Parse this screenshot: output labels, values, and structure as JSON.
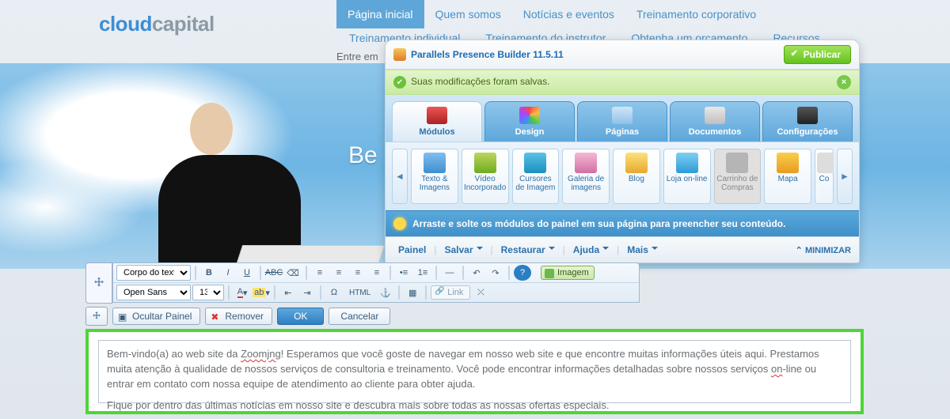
{
  "logo": {
    "part1": "cloud",
    "part2": "capital"
  },
  "nav1": [
    "Página inicial",
    "Quem somos",
    "Notícias e eventos",
    "Treinamento corporativo"
  ],
  "nav2": [
    "Treinamento individual",
    "Treinamento do instrutor",
    "Obtenha um orçamento",
    "Recursos"
  ],
  "subline_prefix": "Entre em",
  "hero_text": "Be",
  "builder": {
    "title": "Parallels Presence Builder 11.5.11",
    "publish": "Publicar",
    "saved_msg": "Suas modificações foram salvas.",
    "tabs": [
      "Módulos",
      "Design",
      "Páginas",
      "Documentos",
      "Configurações"
    ],
    "modules": [
      {
        "label": "Texto & Imagens"
      },
      {
        "label": "Vídeo Incorporado"
      },
      {
        "label": "Cursores de Imagem"
      },
      {
        "label": "Galeria de imagens"
      },
      {
        "label": "Blog"
      },
      {
        "label": "Loja on-line"
      },
      {
        "label": "Carrinho de Compras",
        "disabled": true
      },
      {
        "label": "Mapa"
      },
      {
        "label": "Co"
      }
    ],
    "hint": "Arraste e solte os módulos do painel em sua página para preencher seu conteúdo.",
    "footer": {
      "panel": "Painel",
      "save": "Salvar",
      "restore": "Restaurar",
      "help": "Ajuda",
      "more": "Mais",
      "minimize": "MINIMIZAR"
    }
  },
  "rte": {
    "para_style": "Corpo do texto",
    "font": "Open Sans",
    "size": "13",
    "image_btn": "Imagem",
    "link_btn": "Link",
    "html_btn": "HTML"
  },
  "actions": {
    "hide_panel": "Ocultar Painel",
    "remove": "Remover",
    "ok": "OK",
    "cancel": "Cancelar"
  },
  "content": {
    "p1a": "Bem-vindo(a) ao web site da ",
    "p1_s1": "Zoomjng",
    "p1b": "! Esperamos que você goste de navegar em nosso web site e que encontre muitas informações úteis aqui. Prestamos muita atenção à qualidade de nossos serviços de consultoria e treinamento. Você pode encontrar informações detalhadas sobre nossos serviços ",
    "p1_s2": "on",
    "p1c": "-line ou entrar em contato com nossa equipe de atendimento ao cliente para obter ajuda.",
    "p2": "Fique por dentro das últimas notícias em nosso site e descubra mais sobre todas as nossas ofertas especiais."
  }
}
